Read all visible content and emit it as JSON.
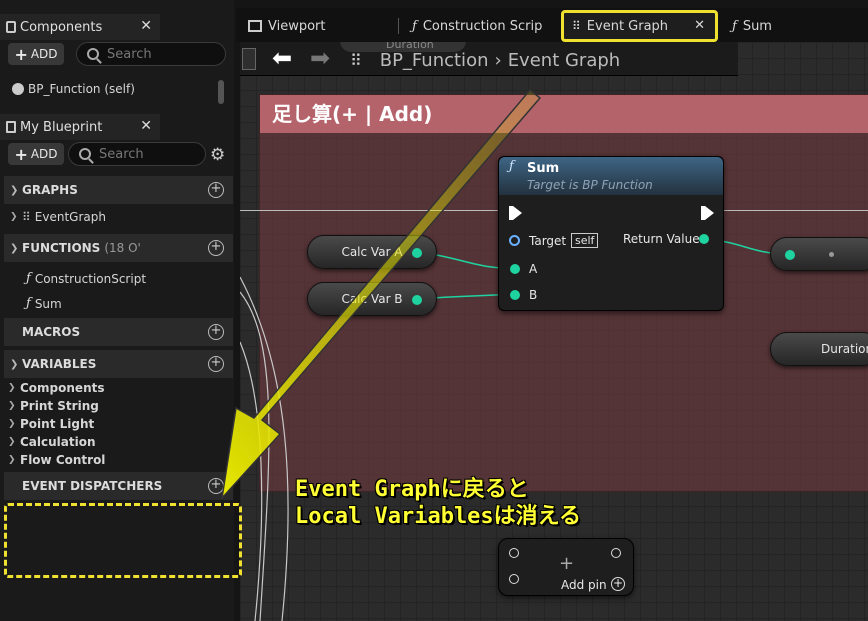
{
  "left_panel": {
    "components_tab": "Components",
    "add_label": "ADD",
    "search_placeholder": "Search",
    "component_item": "BP_Function (self)",
    "blueprint_tab": "My Blueprint",
    "sections": {
      "graphs": "GRAPHS",
      "functions": "FUNCTIONS",
      "functions_count": "(18 O'",
      "macros": "MACROS",
      "variables": "VARIABLES",
      "event_dispatchers": "EVENT DISPATCHERS"
    },
    "graph_items": [
      "EventGraph"
    ],
    "function_items": [
      "ConstructionScript",
      "Sum"
    ],
    "variable_categories": [
      "Components",
      "Print String",
      "Point Light",
      "Calculation",
      "Flow Control"
    ]
  },
  "tabs": [
    {
      "label": "Viewport",
      "icon": "viewport-icon"
    },
    {
      "label": "Construction Scrip",
      "icon": "function-icon"
    },
    {
      "label": "Event Graph",
      "icon": "graph-icon",
      "active": true
    },
    {
      "label": "Sum",
      "icon": "function-icon"
    }
  ],
  "breadcrumb": {
    "blueprint": "BP_Function",
    "graph": "Event Graph"
  },
  "graph": {
    "comment_title": "足し算(+ | Add)",
    "sum_node": {
      "title": "Sum",
      "subtitle": "Target is BP Function",
      "target_label": "Target",
      "target_value": "self",
      "input_a": "A",
      "input_b": "B",
      "output": "Return Value"
    },
    "var_a": "Calc Var A",
    "var_b": "Calc Var B",
    "duration_label": "Duration",
    "duration_top": "Duration",
    "add_pin_label": "Add pin"
  },
  "annotation": {
    "line1": "Event Graphに戻ると",
    "line2": "Local Variablesは消える",
    "arrow_color": "#e8e800",
    "highlight_color": "#f0e030"
  },
  "colors": {
    "float_pin": "#1fd3a0",
    "object_pin": "#6ab0ff",
    "comment_header": "#b5636b"
  }
}
